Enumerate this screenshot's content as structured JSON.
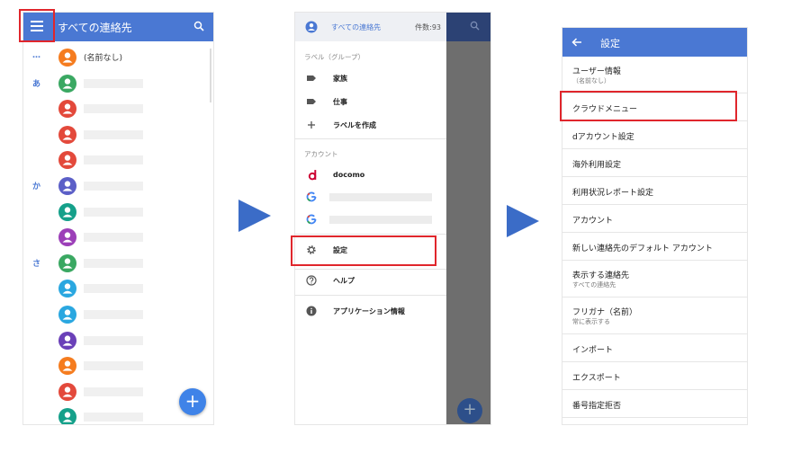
{
  "screen1": {
    "title": "すべての連絡先",
    "fab_label": "+",
    "contacts": [
      {
        "section": "…",
        "name": "(名前なし)",
        "color": "#f57c1f"
      },
      {
        "section": "あ",
        "name": "",
        "color": "#3aa862"
      },
      {
        "section": "",
        "name": "",
        "color": "#e3493b"
      },
      {
        "section": "",
        "name": "",
        "color": "#e3493b"
      },
      {
        "section": "",
        "name": "",
        "color": "#e3493b"
      },
      {
        "section": "か",
        "name": "",
        "color": "#5b5fc7"
      },
      {
        "section": "",
        "name": "",
        "color": "#15a08a"
      },
      {
        "section": "",
        "name": "",
        "color": "#9c3fb8"
      },
      {
        "section": "さ",
        "name": "",
        "color": "#3aa862"
      },
      {
        "section": "",
        "name": "",
        "color": "#2aa7e0"
      },
      {
        "section": "",
        "name": "",
        "color": "#2aa7e0"
      },
      {
        "section": "",
        "name": "",
        "color": "#6a40b8"
      },
      {
        "section": "",
        "name": "",
        "color": "#f57c1f"
      },
      {
        "section": "",
        "name": "",
        "color": "#e3493b"
      },
      {
        "section": "",
        "name": "",
        "color": "#15a08a"
      },
      {
        "section": "",
        "name": "",
        "color": "#15a08a"
      }
    ]
  },
  "screen2": {
    "title": "すべての連絡先",
    "count": "件数:93",
    "labels_section": "ラベル（グループ）",
    "family": "家族",
    "work": "仕事",
    "create_label": "ラベルを作成",
    "accounts_section": "アカウント",
    "docomo": "docomo",
    "settings": "設定",
    "help": "ヘルプ",
    "app_info": "アプリケーション情報",
    "fab_label": "+"
  },
  "screen3": {
    "title": "設定",
    "items": [
      {
        "label": "ユーザー情報",
        "sub": "（名前なし）"
      },
      {
        "label": "クラウドメニュー",
        "sub": ""
      },
      {
        "label": "dアカウント設定",
        "sub": ""
      },
      {
        "label": "海外利用設定",
        "sub": ""
      },
      {
        "label": "利用状況レポート設定",
        "sub": ""
      },
      {
        "label": "アカウント",
        "sub": ""
      },
      {
        "label": "新しい連絡先のデフォルト アカウント",
        "sub": ""
      },
      {
        "label": "表示する連絡先",
        "sub": "すべての連絡先"
      },
      {
        "label": "フリガナ（名前）",
        "sub": "常に表示する"
      },
      {
        "label": "インポート",
        "sub": ""
      },
      {
        "label": "エクスポート",
        "sub": ""
      },
      {
        "label": "番号指定拒否",
        "sub": ""
      }
    ]
  },
  "colors": {
    "accent": "#4a78d3",
    "highlight": "#e0262c",
    "arrow": "#3b6cc7",
    "docomo_red": "#cc0033"
  }
}
